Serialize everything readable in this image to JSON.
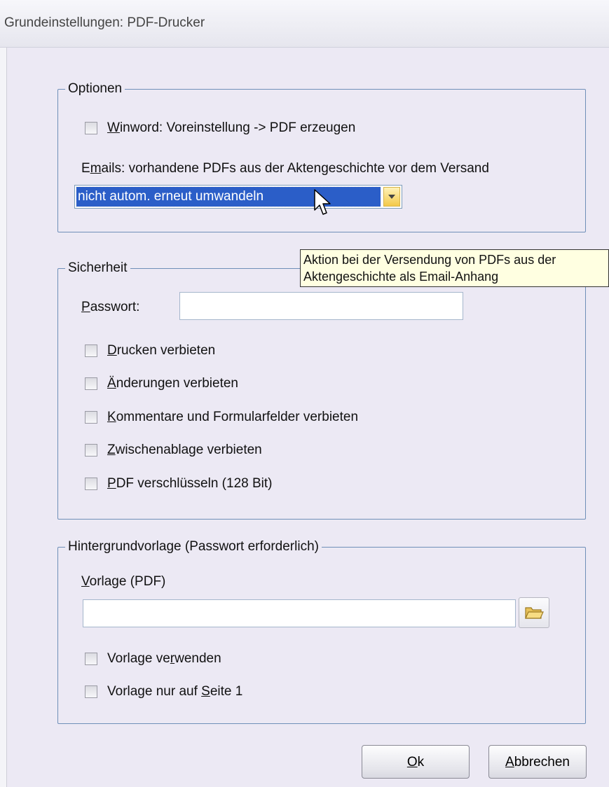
{
  "window": {
    "title": "Grundeinstellungen: PDF-Drucker"
  },
  "optionen": {
    "legend": "Optionen",
    "winword_checkbox": {
      "mnemonic": "W",
      "rest": "inword: Voreinstellung -> PDF erzeugen",
      "checked": false
    },
    "emails_label": {
      "pre": "E",
      "mnemonic": "m",
      "rest": "ails: vorhandene PDFs aus der Aktengeschichte vor dem Versand"
    },
    "emails_select": {
      "value": "nicht autom. erneut umwandeln"
    }
  },
  "tooltip": {
    "line1": "Aktion bei der Versendung von PDFs aus der",
    "line2": "Aktengeschichte als Email-Anhang"
  },
  "sicherheit": {
    "legend": "Sicherheit",
    "passwort_label": {
      "mnemonic": "P",
      "rest": "asswort:"
    },
    "passwort_value": "",
    "checkboxes": [
      {
        "pre": "",
        "mnemonic": "D",
        "rest": "rucken verbieten",
        "checked": false
      },
      {
        "pre": "",
        "mnemonic": "Ä",
        "rest": "nderungen verbieten",
        "checked": false
      },
      {
        "pre": "",
        "mnemonic": "K",
        "rest": "ommentare und Formularfelder verbieten",
        "checked": false
      },
      {
        "pre": "",
        "mnemonic": "Z",
        "rest": "wischenablage verbieten",
        "checked": false
      },
      {
        "pre": "",
        "mnemonic": "P",
        "rest": "DF verschlüsseln (128 Bit)",
        "checked": false
      }
    ]
  },
  "hintergrund": {
    "legend": "Hintergrundvorlage (Passwort erforderlich)",
    "vorlage_label": {
      "mnemonic": "V",
      "rest": "orlage (PDF)"
    },
    "vorlage_value": "",
    "checkboxes": [
      {
        "pre": "Vorlage ve",
        "mnemonic": "r",
        "rest": "wenden",
        "checked": false
      },
      {
        "pre": "Vorlage nur auf ",
        "mnemonic": "S",
        "rest": "eite 1",
        "checked": false
      }
    ]
  },
  "buttons": {
    "ok": {
      "mnemonic": "O",
      "rest": "k"
    },
    "cancel": {
      "mnemonic": "A",
      "rest": "bbrechen"
    }
  },
  "colors": {
    "selection": "#2b5ec8",
    "tooltip_bg": "#ffffe1",
    "group_border": "#6f8fb8"
  },
  "icons": {
    "dropdown": "chevron-down-icon",
    "browse": "folder-icon",
    "pointer": "mouse-pointer-icon"
  }
}
